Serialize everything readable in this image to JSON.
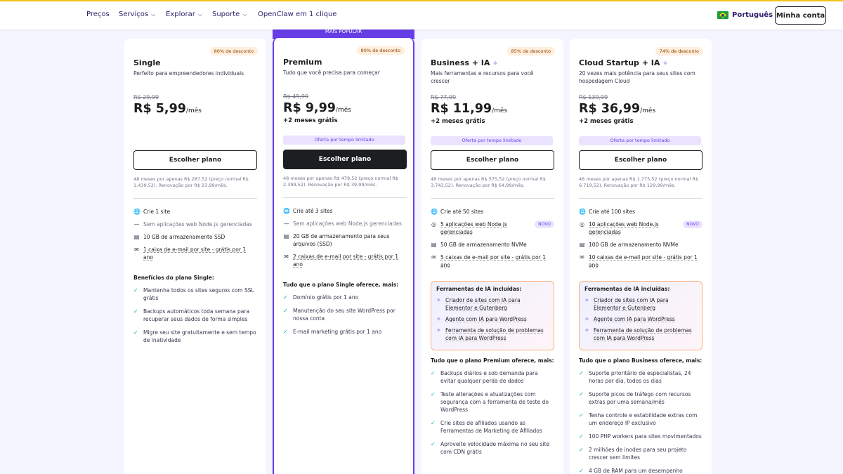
{
  "header": {
    "nav": [
      {
        "label": "Preços",
        "dropdown": false
      },
      {
        "label": "Serviços",
        "dropdown": true
      },
      {
        "label": "Explorar",
        "dropdown": true
      },
      {
        "label": "Suporte",
        "dropdown": true
      },
      {
        "label": "OpenClaw em 1 clique",
        "dropdown": false
      }
    ],
    "language": "Português",
    "account_button": "Minha conta"
  },
  "popular_strip": "MAIS POPULAR",
  "plans": [
    {
      "discount": "80% de desconto",
      "name": "Single",
      "description": "Perfeito para empreendedores individuais",
      "old_price": "R$ 29,99",
      "price": "R$ 5,99",
      "per": "/mês",
      "free_months": "",
      "offer": "",
      "button": "Escolher plano",
      "renewal": "48 meses por apenas R$ 287,52 (preço normal R$ 1.439,52). Renovação por R$ 23,99/mês.",
      "features": [
        {
          "icon": "globe-icon",
          "text": "Crie 1 site"
        },
        {
          "icon": "dash-icon",
          "text": "Sem aplicações web Node.js gerenciadas"
        },
        {
          "icon": "storage-icon",
          "text": "10 GB de armazenamento SSD"
        },
        {
          "icon": "mail-icon",
          "text": "1 caixa de e-mail por site - grátis por 1 ano"
        }
      ],
      "benefits_title": "Benefícios do plano Single:",
      "benefits": [
        "Mantenha todos os sites seguros com SSL grátis",
        "Backups automáticos toda semana para recuperar seus dados de forma simples",
        "Migre seu site gratuitamente e sem tempo de inatividade"
      ]
    },
    {
      "discount": "80% de desconto",
      "name": "Premium",
      "description": "Tudo que você precisa para começar",
      "old_price": "R$ 49,99",
      "price": "R$ 9,99",
      "per": "/mês",
      "free_months": "+2 meses grátis",
      "offer": "Oferta por tempo limitado",
      "button": "Escolher plano",
      "renewal": "48 meses por apenas R$ 479,52 (preço normal R$ 2.399,52). Renovação por R$ 39,99/mês.",
      "features": [
        {
          "icon": "globe-icon",
          "text": "Crie até 3 sites"
        },
        {
          "icon": "dash-icon",
          "text": "Sem aplicações web Node.js gerenciadas"
        },
        {
          "icon": "storage-icon",
          "text": "20 GB de armazenamento para seus arquivos (SSD)"
        },
        {
          "icon": "mail-icon",
          "text": "2 caixas de e-mail por site - grátis por 1 ano"
        }
      ],
      "benefits_title": "Tudo que o plano Single oferece, mais:",
      "benefits": [
        "Domínio grátis por 1 ano",
        "Manutenção do seu site WordPress por nossa conta",
        "E-mail marketing grátis por 1 ano"
      ]
    },
    {
      "discount": "85% de desconto",
      "name": "Business + IA",
      "description": "Mais ferramentas e recursos para você crescer",
      "old_price": "R$ 77,99",
      "price": "R$ 11,99",
      "per": "/mês",
      "free_months": "+2 meses grátis",
      "offer": "Oferta por tempo limitado",
      "button": "Escolher plano",
      "renewal": "48 meses por apenas R$ 575,52 (preço normal R$ 3.743,52). Renovação por R$ 64,99/mês.",
      "features": [
        {
          "icon": "globe-icon",
          "text": "Crie até 50 sites"
        },
        {
          "icon": "node-icon",
          "text": "5 aplicações web Node.js gerenciadas",
          "badge": "NOVO"
        },
        {
          "icon": "storage-icon",
          "text": "50 GB de armazenamento NVMe"
        },
        {
          "icon": "mail-icon",
          "text": "5 caixas de e-mail por site - grátis por 1 ano"
        }
      ],
      "ai_title": "Ferramentas de IA incluídas:",
      "ai_tools": [
        "Criador de sites com IA para Elementor e Gutenberg",
        "Agente com IA para WordPress",
        "Ferramenta de solução de problemas com IA para WordPress"
      ],
      "benefits_title": "Tudo que o plano Premium oferece, mais:",
      "benefits": [
        "Backups diários e sob demanda para evitar qualquer perda de dados",
        "Teste alterações e atualizações com segurança com a ferramenta de teste do WordPress",
        "Crie sites de afiliados usando as Ferramentas de Marketing de Afiliados",
        "Aproveite velocidade máxima no seu site com CDN grátis"
      ]
    },
    {
      "discount": "74% de desconto",
      "name": "Cloud Startup + IA",
      "description": "20 vezes mais potência para seus sites com hospedagem Cloud",
      "old_price": "R$ 139,99",
      "price": "R$ 36,99",
      "per": "/mês",
      "free_months": "+2 meses grátis",
      "offer": "Oferta por tempo limitado",
      "button": "Escolher plano",
      "renewal": "48 meses por apenas R$ 1.775,52 (preço normal R$ 6.719,52). Renovação por R$ 129,99/mês.",
      "features": [
        {
          "icon": "globe-icon",
          "text": "Crie até 100 sites"
        },
        {
          "icon": "node-icon",
          "text": "10 aplicações web Node.js gerenciadas",
          "badge": "NOVO"
        },
        {
          "icon": "storage-icon",
          "text": "100 GB de armazenamento NVMe"
        },
        {
          "icon": "mail-icon",
          "text": "10 caixas de e-mail por site - grátis por 1 ano"
        }
      ],
      "ai_title": "Ferramentas de IA incluídas:",
      "ai_tools": [
        "Criador de sites com IA para Elementor e Gutenberg",
        "Agente com IA para WordPress",
        "Ferramenta de solução de problemas com IA para WordPress"
      ],
      "benefits_title": "Tudo que o plano Business oferece, mais:",
      "benefits": [
        "Suporte prioritário de especialistas, 24 horas por dia, todos os dias",
        "Suporte picos de tráfego com recursos extras por uma semana/mês",
        "Tenha controle e estabilidade extras com um endereço IP exclusivo",
        "100 PHP workers para sites movimentados",
        "2 milhões de inodes para seu projeto crescer sem limites",
        "4 GB de RAM para um desempenho estável"
      ]
    }
  ]
}
